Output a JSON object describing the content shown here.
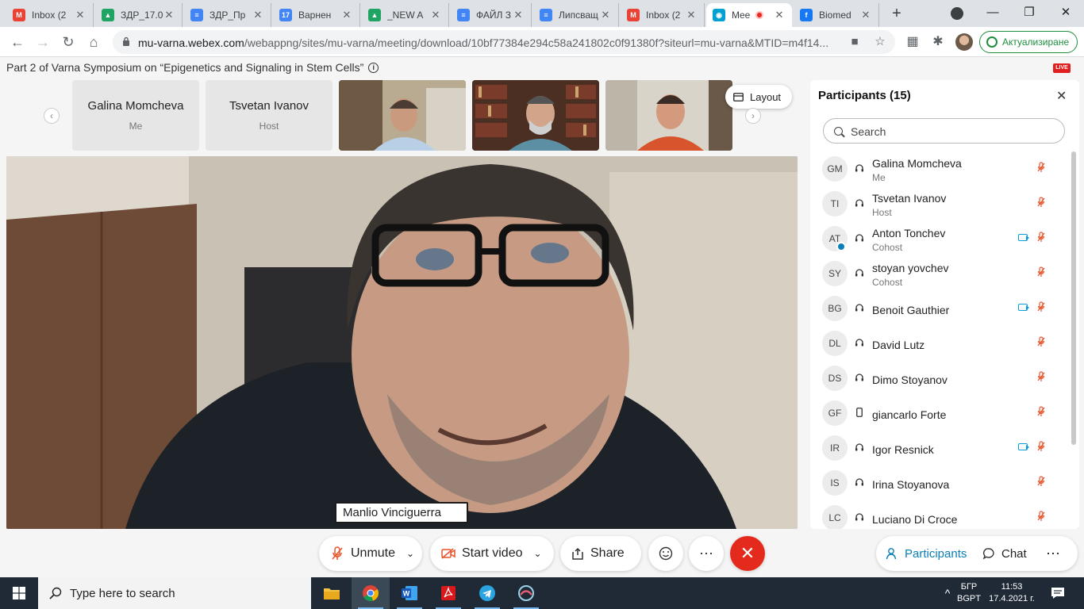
{
  "browser": {
    "tabs": [
      {
        "title": "Inbox (2",
        "color": "#ea4335",
        "glyph": "M"
      },
      {
        "title": "ЗДР_17.0",
        "color": "#1fa463",
        "glyph": "▲"
      },
      {
        "title": "ЗДР_Пр",
        "color": "#4285f4",
        "glyph": "≡"
      },
      {
        "title": "Варнен",
        "color": "#4285f4",
        "glyph": "17"
      },
      {
        "title": "_NEW A",
        "color": "#1fa463",
        "glyph": "▲"
      },
      {
        "title": "ФАЙЛ З",
        "color": "#4285f4",
        "glyph": "≡"
      },
      {
        "title": "Липсващ",
        "color": "#4285f4",
        "glyph": "≡"
      },
      {
        "title": "Inbox (2",
        "color": "#ea4335",
        "glyph": "M"
      },
      {
        "title": "Mee",
        "color": "#00a0d1",
        "glyph": "◉"
      },
      {
        "title": "Biomed",
        "color": "#1877f2",
        "glyph": "f"
      }
    ],
    "url_host": "mu-varna.webex.com",
    "url_path": "/webappng/sites/mu-varna/meeting/download/10bf77384e294c58a241802c0f91380f?siteurl=mu-varna&MTID=m4f14...",
    "update_label": "Актуализиране"
  },
  "meeting": {
    "title": "Part 2 of Varna Symposium on “Epigenetics and Signaling in Stem Cells”",
    "live_label": "LIVE",
    "layout_label": "Layout",
    "active_speaker": "Manlio Vinciguerra",
    "thumbnails": [
      {
        "name": "Galina Momcheva",
        "role": "Me"
      },
      {
        "name": "Tsvetan Ivanov",
        "role": "Host"
      }
    ]
  },
  "participants": {
    "title": "Participants (15)",
    "search_placeholder": "Search",
    "list": [
      {
        "initials": "GM",
        "name": "Galina Momcheva",
        "role": "Me",
        "device": "headset",
        "video": false,
        "badge": false
      },
      {
        "initials": "TI",
        "name": "Tsvetan Ivanov",
        "role": "Host",
        "device": "headset",
        "video": false,
        "badge": false
      },
      {
        "initials": "AT",
        "name": "Anton Tonchev",
        "role": "Cohost",
        "device": "headset",
        "video": true,
        "badge": true
      },
      {
        "initials": "SY",
        "name": "stoyan yovchev",
        "role": "Cohost",
        "device": "headset",
        "video": false,
        "badge": false
      },
      {
        "initials": "BG",
        "name": "Benoit Gauthier",
        "role": "",
        "device": "headset",
        "video": true,
        "badge": false
      },
      {
        "initials": "DL",
        "name": "David Lutz",
        "role": "",
        "device": "headset",
        "video": false,
        "badge": false
      },
      {
        "initials": "DS",
        "name": "Dimo Stoyanov",
        "role": "",
        "device": "headset",
        "video": false,
        "badge": false
      },
      {
        "initials": "GF",
        "name": "giancarlo Forte",
        "role": "",
        "device": "phone",
        "video": false,
        "badge": false
      },
      {
        "initials": "IR",
        "name": "Igor Resnick",
        "role": "",
        "device": "headset",
        "video": true,
        "badge": false
      },
      {
        "initials": "IS",
        "name": "Irina Stoyanova",
        "role": "",
        "device": "headset",
        "video": false,
        "badge": false
      },
      {
        "initials": "LC",
        "name": "Luciano Di Croce",
        "role": "",
        "device": "headset",
        "video": false,
        "badge": false
      }
    ]
  },
  "controls": {
    "unmute_label": "Unmute",
    "start_video_label": "Start video",
    "share_label": "Share",
    "participants_label": "Participants",
    "chat_label": "Chat"
  },
  "taskbar": {
    "search_placeholder": "Type here to search",
    "lang_top": "БГР",
    "lang_bottom": "BGPT",
    "time": "11:53",
    "date": "17.4.2021 г."
  },
  "colors": {
    "accent": "#0a7fb8",
    "muted_mic": "#e8532a",
    "leave": "#e42a1c"
  }
}
